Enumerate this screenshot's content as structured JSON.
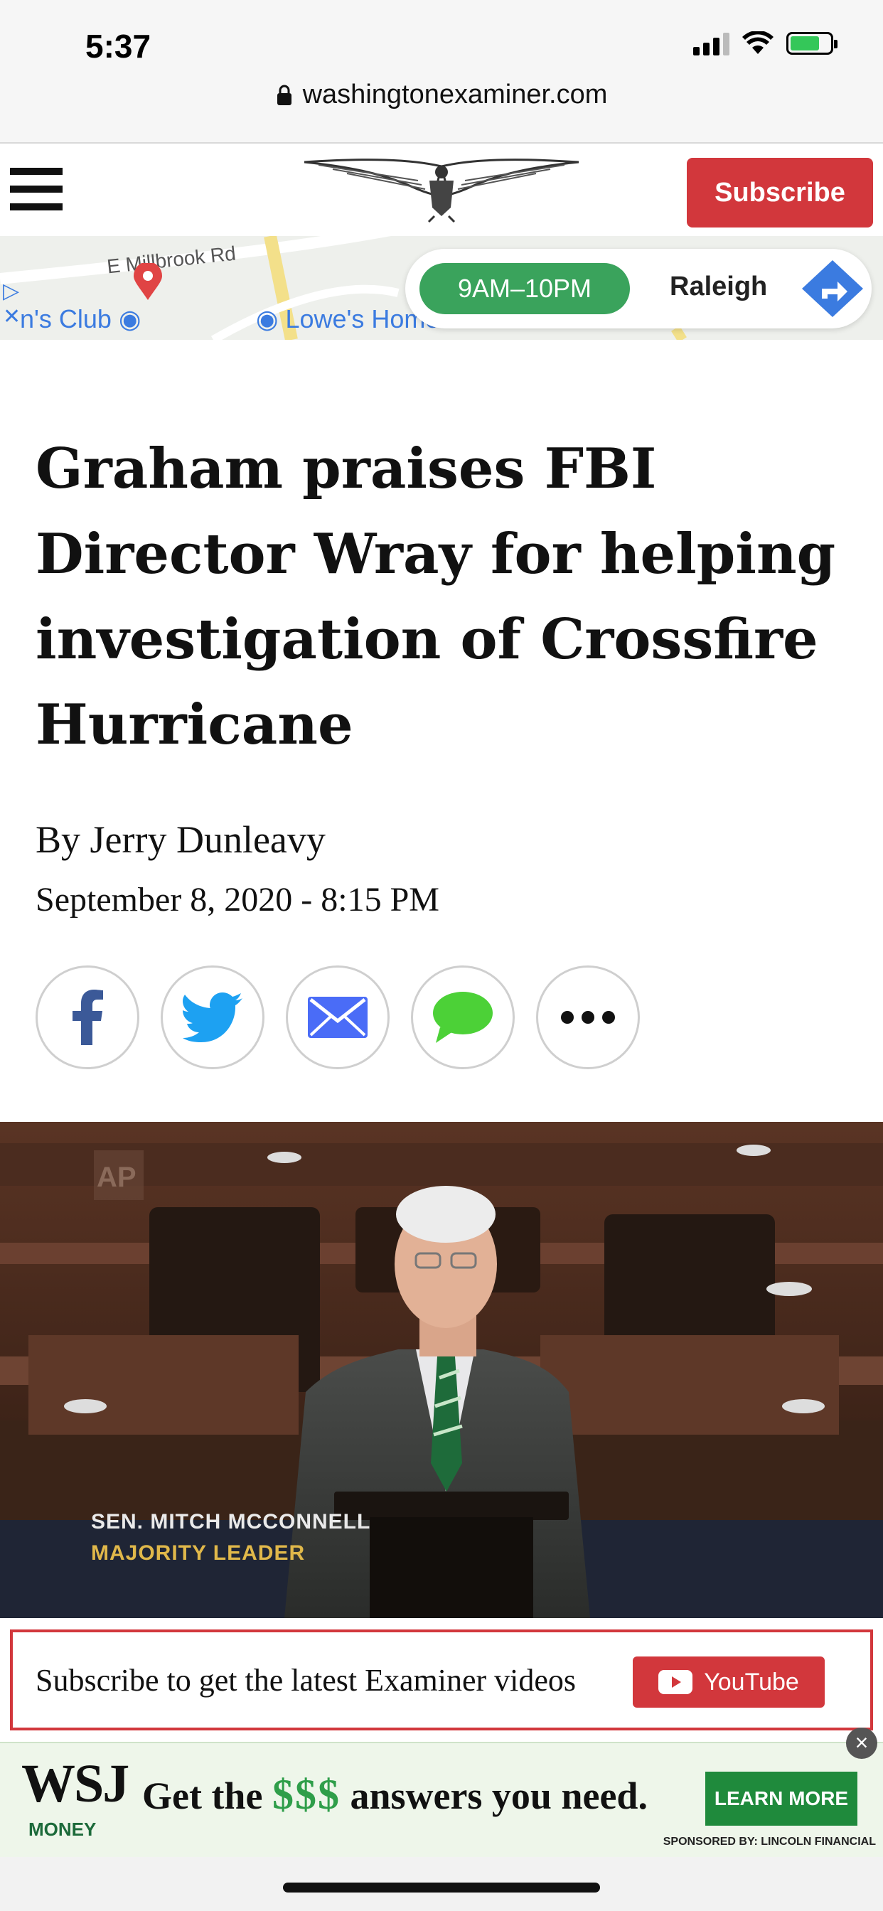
{
  "status_bar": {
    "time": "5:37"
  },
  "browser": {
    "url": "washingtonexaminer.com"
  },
  "header": {
    "subscribe_label": "Subscribe"
  },
  "map_ad": {
    "street": "E Millbrook Rd",
    "place_left": "n's Club",
    "place_right": "Lowe's Home",
    "hours": "9AM–10PM",
    "city": "Raleigh"
  },
  "article": {
    "headline": "Graham praises FBI Director Wray for helping investigation of Crossfire Hurricane",
    "byline": "By Jerry Dunleavy",
    "date": "September 8, 2020 - 8:15 PM"
  },
  "video": {
    "watermark": "AP",
    "caption_name": "SEN. MITCH MCCONNELL",
    "caption_title": "MAJORITY LEADER"
  },
  "video_cta": {
    "text": "Subscribe to get the latest Examiner videos",
    "youtube_label": "YouTube"
  },
  "wsj_ad": {
    "logo": "WSJ",
    "logo_sub": "MONEY",
    "tagline_pre": "Get the",
    "tagline_dollars": "$$$",
    "tagline_post": "answers you need.",
    "button": "LEARN MORE",
    "sponsored": "SPONSORED BY: LINCOLN FINANCIAL"
  },
  "colors": {
    "brand_red": "#d2373c",
    "map_green": "#3aa35c",
    "facebook": "#3b5998",
    "twitter": "#1da1f2",
    "email": "#4a6cf7",
    "messages": "#4cd137"
  }
}
